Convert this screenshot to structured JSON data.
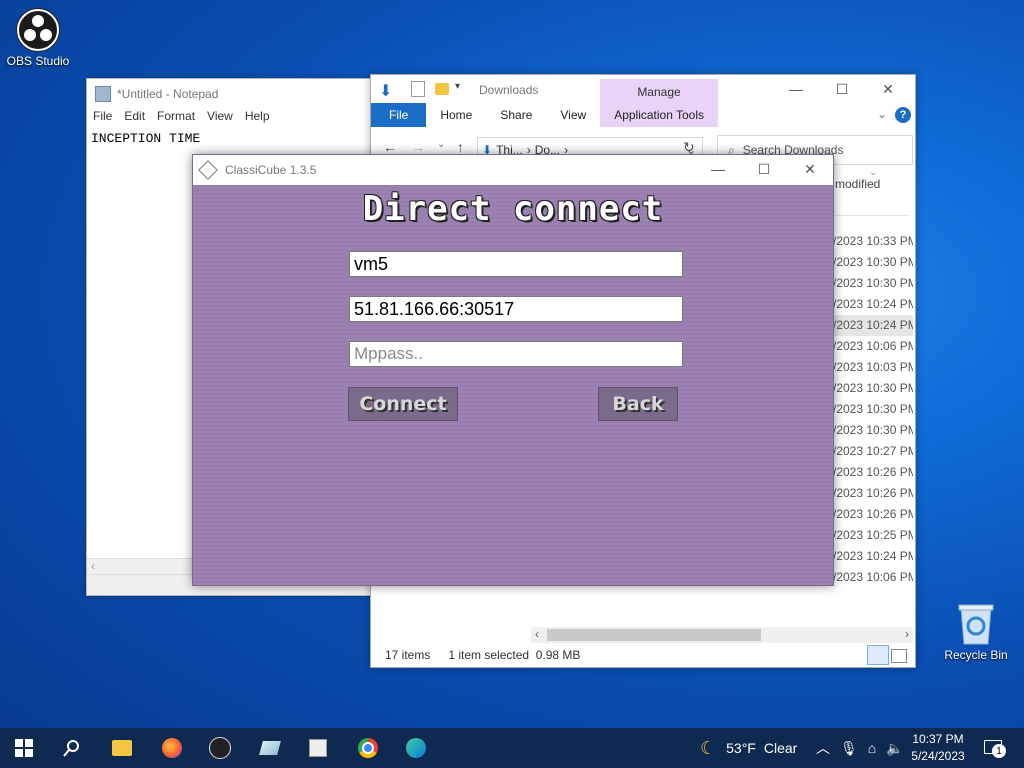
{
  "desktop": {
    "icons": [
      {
        "label": "OBS Studio",
        "icon": "obs-icon"
      },
      {
        "label": "Recycle Bin",
        "icon": "recycle-bin-icon"
      }
    ]
  },
  "notepad": {
    "title": "*Untitled - Notepad",
    "menu": [
      "File",
      "Edit",
      "Format",
      "View",
      "Help"
    ],
    "content": "INCEPTION TIME"
  },
  "explorer": {
    "title": "Downloads",
    "contextual_group": "Manage",
    "tabs": [
      "File",
      "Home",
      "Share",
      "View",
      "Application Tools"
    ],
    "address_parts": [
      "Thi...",
      "Do..."
    ],
    "search_placeholder": "Search Downloads",
    "column_header": "modified",
    "rows": [
      "/2023 10:33 PM",
      "/2023 10:30 PM",
      "/2023 10:30 PM",
      "/2023 10:24 PM",
      "/2023 10:24 PM",
      "/2023 10:06 PM",
      "/2023 10:03 PM",
      "/2023 10:30 PM",
      "/2023 10:30 PM",
      "/2023 10:30 PM",
      "/2023 10:27 PM",
      "/2023 10:26 PM",
      "/2023 10:26 PM",
      "/2023 10:26 PM",
      "/2023 10:25 PM",
      "/2023 10:24 PM",
      "/2023 10:06 PM"
    ],
    "selected_row": 4,
    "status_count": "17 items",
    "status_selection": "1 item selected  0.98 MB"
  },
  "classicube": {
    "title": "ClassiCube 1.3.5",
    "heading": "Direct connect",
    "username": "vm5",
    "address": "51.81.166.66:30517",
    "mppass_placeholder": "Mppass..",
    "connect_label": "Connect",
    "back_label": "Back"
  },
  "taskbar": {
    "weather_temp": "53°F",
    "weather_desc": "Clear",
    "time": "10:37 PM",
    "date": "5/24/2023",
    "notification_count": "1"
  }
}
